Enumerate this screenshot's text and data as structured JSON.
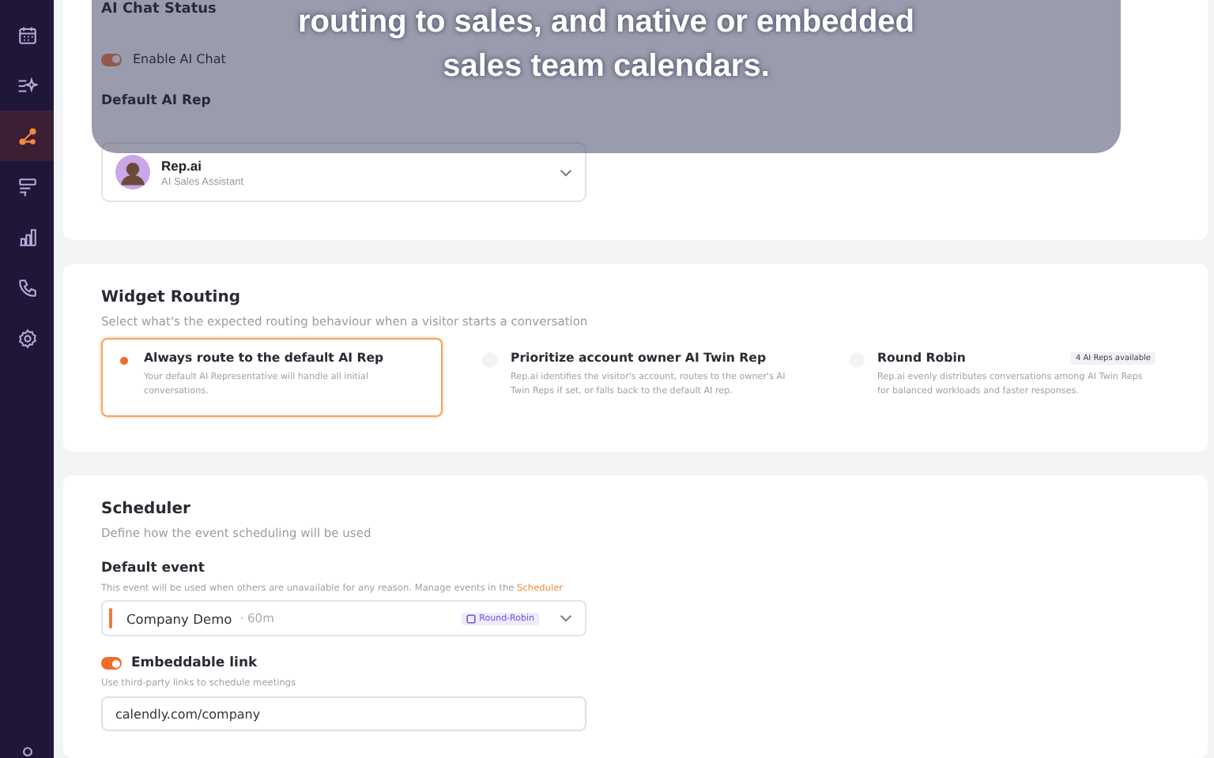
{
  "sidebar": {
    "items": [
      {
        "kind": "calendar",
        "selected": false
      },
      {
        "kind": "sparkle-list",
        "selected": false
      },
      {
        "kind": "routing",
        "selected": true
      },
      {
        "kind": "form",
        "selected": false
      },
      {
        "kind": "chart",
        "selected": false
      },
      {
        "kind": "phone",
        "selected": false
      },
      {
        "kind": "gear",
        "selected": false
      },
      {
        "kind": "user",
        "selected": false
      }
    ]
  },
  "overlay": {
    "lines": [
      "routing to sales, and native or embedded",
      "sales team calendars."
    ]
  },
  "ai_chat": {
    "title": "AI Chat Status",
    "toggle": {
      "label": "Enable AI Chat",
      "on": true
    }
  },
  "default_rep": {
    "title": "Default AI Rep",
    "name": "Rep.ai",
    "role": "AI Sales Assistant"
  },
  "widget_routing": {
    "title": "Widget Routing",
    "subtitle": "Select what's the expected routing behaviour when a visitor starts a conversation",
    "options": [
      {
        "title": "Always route to the default AI Rep",
        "description": "Your default AI Representative will handle all initial conversations.",
        "selected": true
      },
      {
        "title": "Prioritize account owner AI Twin Rep",
        "description": "Rep.ai identifies the visitor's account, routes to the owner's AI Twin Reps if set, or falls back to the default AI rep.",
        "selected": false
      },
      {
        "title": "Round Robin",
        "badge": "4 AI Reps available",
        "description": "Rep.ai evenly distributes conversations among AI Twin Reps for balanced workloads and faster responses.",
        "selected": false
      }
    ]
  },
  "scheduler": {
    "title": "Scheduler",
    "subtitle": "Define how the event scheduling will be used",
    "default_event": {
      "label": "Default event",
      "hint": "This event will be used when others are unavailable for any reason. Manage events in the",
      "hint_link": "Scheduler",
      "event": "Company Demo",
      "duration": "· 60m",
      "badge": "Round-Robin"
    },
    "embed": {
      "label": "Embeddable link",
      "on": true,
      "hint": "Use third-party links to schedule meetings",
      "value": "calendly.com/company"
    }
  }
}
